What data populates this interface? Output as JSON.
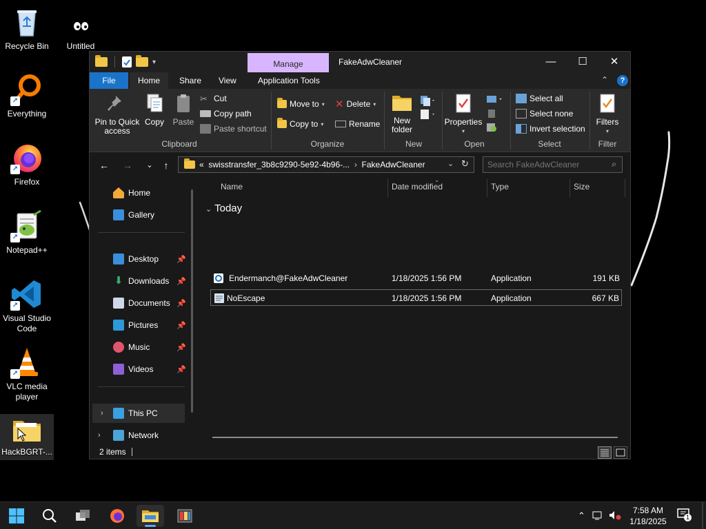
{
  "desktop": {
    "icons": [
      {
        "label": "Recycle Bin",
        "icon": "recycle-bin-icon"
      },
      {
        "label": "Untitled",
        "icon": "untitled-icon"
      },
      {
        "label": "Everything",
        "icon": "everything-search-icon"
      },
      {
        "label": "Firefox",
        "icon": "firefox-icon"
      },
      {
        "label": "Notepad++",
        "icon": "notepadpp-icon"
      },
      {
        "label": "Visual Studio Code",
        "icon": "vscode-icon"
      },
      {
        "label": "VLC media player",
        "icon": "vlc-icon"
      },
      {
        "label": "HackBGRT-...",
        "icon": "folder-icon"
      }
    ]
  },
  "window": {
    "title": "FakeAdwCleaner",
    "context_tab": "Manage",
    "tabs": [
      "File",
      "Home",
      "Share",
      "View",
      "Application Tools"
    ],
    "ribbon": {
      "clipboard": {
        "label": "Clipboard",
        "pin": "Pin to Quick access",
        "copy": "Copy",
        "paste": "Paste",
        "cut": "Cut",
        "copy_path": "Copy path",
        "paste_shortcut": "Paste shortcut"
      },
      "organize": {
        "label": "Organize",
        "move_to": "Move to",
        "copy_to": "Copy to",
        "delete": "Delete",
        "rename": "Rename"
      },
      "new": {
        "label": "New",
        "new_folder": "New folder"
      },
      "open": {
        "label": "Open",
        "properties": "Properties"
      },
      "select": {
        "label": "Select",
        "select_all": "Select all",
        "select_none": "Select none",
        "invert": "Invert selection"
      },
      "filter": {
        "label": "Filter",
        "filters": "Filters"
      }
    },
    "address": {
      "crumb_overflow": "«",
      "crumb_parent": "swisstransfer_3b8c9290-5e92-4b96-...",
      "crumb_current": "FakeAdwCleaner"
    },
    "search_placeholder": "Search FakeAdwCleaner",
    "nav": {
      "home": "Home",
      "gallery": "Gallery",
      "desktop": "Desktop",
      "downloads": "Downloads",
      "documents": "Documents",
      "pictures": "Pictures",
      "music": "Music",
      "videos": "Videos",
      "this_pc": "This PC",
      "network": "Network"
    },
    "columns": {
      "name": "Name",
      "date": "Date modified",
      "type": "Type",
      "size": "Size"
    },
    "group": "Today",
    "files": [
      {
        "name": "Endermanch@FakeAdwCleaner",
        "date": "1/18/2025 1:56 PM",
        "type": "Application",
        "size": "191 KB"
      },
      {
        "name": "NoEscape",
        "date": "1/18/2025 1:56 PM",
        "type": "Application",
        "size": "667 KB"
      }
    ],
    "status": "2 items"
  },
  "taskbar": {
    "time": "7:58 AM",
    "date": "1/18/2025",
    "notification_count": "1"
  },
  "colors": {
    "accent": "#1a73c8",
    "manage_tab": "#d7b6ff",
    "window_bg": "#191919"
  }
}
